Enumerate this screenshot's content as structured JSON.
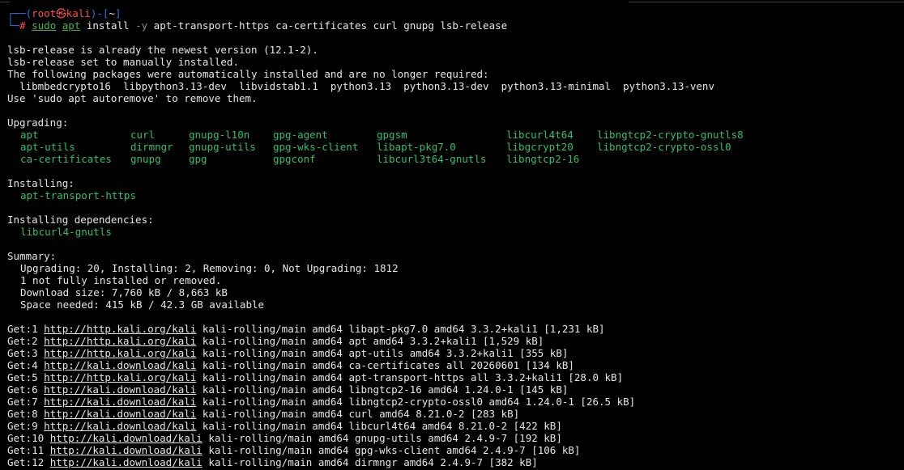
{
  "prompt": {
    "line1_prefix": "┌──(",
    "user": "root",
    "at": "㉿",
    "host": "kali",
    "mid": ")-[",
    "dir": "~",
    "end": "]",
    "line2_prefix": "└─",
    "hash": "# ",
    "cmd_sudo": "sudo",
    "cmd_apt": "apt",
    "cmd_install": " install ",
    "cmd_flag": "-y",
    "cmd_args": " apt-transport-https ca-certificates curl gnupg lsb-release"
  },
  "lines_a": [
    "lsb-release is already the newest version (12.1-2).",
    "lsb-release set to manually installed.",
    "The following packages were automatically installed and are no longer required:",
    "  libmbedcrypto16  libpython3.13-dev  libvidstab1.1  python3.13  python3.13-dev  python3.13-minimal  python3.13-venv",
    "Use 'sudo apt autoremove' to remove them."
  ],
  "upgrading_label": "Upgrading:",
  "upgrading": [
    [
      "apt",
      "curl",
      "gnupg-l10n",
      "gpg-agent",
      "gpgsm",
      "libcurl4t64",
      "libngtcp2-crypto-gnutls8"
    ],
    [
      "apt-utils",
      "dirmngr",
      "gnupg-utils",
      "gpg-wks-client",
      "libapt-pkg7.0",
      "libgcrypt20",
      "libngtcp2-crypto-ossl0"
    ],
    [
      "ca-certificates",
      "gnupg",
      "gpg",
      "gpgconf",
      "libcurl3t64-gnutls",
      "libngtcp2-16",
      ""
    ]
  ],
  "installing_label": "Installing:",
  "installing": "apt-transport-https",
  "deps_label": "Installing dependencies:",
  "deps": "libcurl4-gnutls",
  "summary_label": "Summary:",
  "summary": [
    "Upgrading: 20, Installing: 2, Removing: 0, Not Upgrading: 1812",
    "1 not fully installed or removed.",
    "Download size: 7,760 kB / 8,663 kB",
    "Space needed: 415 kB / 42.3 GB available"
  ],
  "gets": [
    {
      "prefix": "Get:1 ",
      "url": "http://http.kali.org/kali",
      "rest": " kali-rolling/main amd64 libapt-pkg7.0 amd64 3.3.2+kali1 [1,231 kB]"
    },
    {
      "prefix": "Get:2 ",
      "url": "http://http.kali.org/kali",
      "rest": " kali-rolling/main amd64 apt amd64 3.3.2+kali1 [1,529 kB]"
    },
    {
      "prefix": "Get:3 ",
      "url": "http://http.kali.org/kali",
      "rest": " kali-rolling/main amd64 apt-utils amd64 3.3.2+kali1 [355 kB]"
    },
    {
      "prefix": "Get:4 ",
      "url": "http://kali.download/kali",
      "rest": " kali-rolling/main amd64 ca-certificates all 20260601 [134 kB]"
    },
    {
      "prefix": "Get:5 ",
      "url": "http://http.kali.org/kali",
      "rest": " kali-rolling/main amd64 apt-transport-https all 3.3.2+kali1 [28.0 kB]"
    },
    {
      "prefix": "Get:6 ",
      "url": "http://kali.download/kali",
      "rest": " kali-rolling/main amd64 libngtcp2-16 amd64 1.24.0-1 [145 kB]"
    },
    {
      "prefix": "Get:7 ",
      "url": "http://kali.download/kali",
      "rest": " kali-rolling/main amd64 libngtcp2-crypto-ossl0 amd64 1.24.0-1 [26.5 kB]"
    },
    {
      "prefix": "Get:8 ",
      "url": "http://kali.download/kali",
      "rest": " kali-rolling/main amd64 curl amd64 8.21.0-2 [283 kB]"
    },
    {
      "prefix": "Get:9 ",
      "url": "http://kali.download/kali",
      "rest": " kali-rolling/main amd64 libcurl4t64 amd64 8.21.0-2 [422 kB]"
    },
    {
      "prefix": "Get:10 ",
      "url": "http://kali.download/kali",
      "rest": " kali-rolling/main amd64 gnupg-utils amd64 2.4.9-7 [192 kB]"
    },
    {
      "prefix": "Get:11 ",
      "url": "http://kali.download/kali",
      "rest": " kali-rolling/main amd64 gpg-wks-client amd64 2.4.9-7 [106 kB]"
    },
    {
      "prefix": "Get:12 ",
      "url": "http://kali.download/kali",
      "rest": " kali-rolling/main amd64 dirmngr amd64 2.4.9-7 [382 kB]"
    }
  ]
}
